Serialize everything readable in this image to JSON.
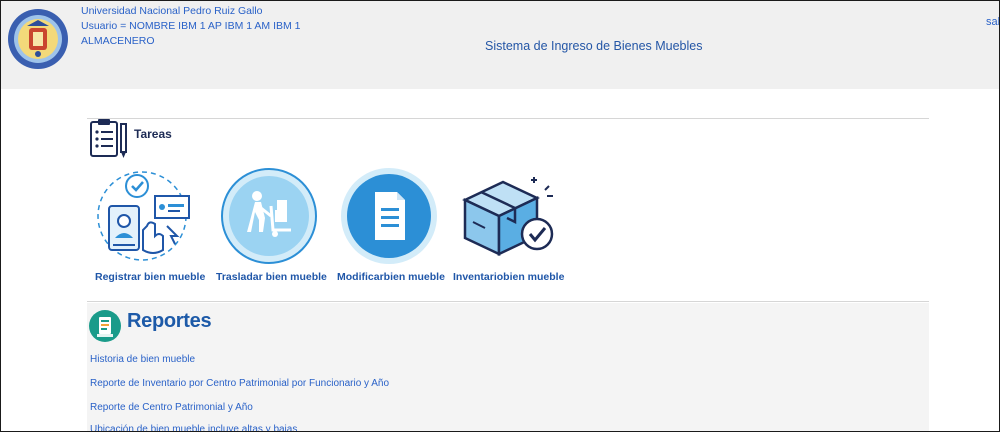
{
  "header": {
    "university": "Universidad Nacional Pedro Ruiz Gallo",
    "user_line": "Usuario = NOMBRE IBM 1 AP IBM 1 AM IBM 1",
    "role": "ALMACENERO",
    "system_title": "Sistema de Ingreso de Bienes Muebles",
    "logout": "sal"
  },
  "tareas": {
    "title": "Tareas",
    "items": [
      {
        "label": "Registrar bien mueble",
        "icon": "register-user-icon"
      },
      {
        "label": "Trasladar bien mueble",
        "icon": "hand-truck-icon"
      },
      {
        "label": "Modificarbien mueble",
        "icon": "document-icon"
      },
      {
        "label": "Inventariobien mueble",
        "icon": "box-check-icon"
      }
    ]
  },
  "reportes": {
    "title": "Reportes",
    "links": [
      "Historia de bien mueble",
      "Reporte de Inventario por Centro Patrimonial por Funcionario y Año",
      "Reporte de Centro Patrimonial y Año",
      "Ubicación de bien mueble incluye altas y bajas"
    ]
  },
  "colors": {
    "header_bg": "#f0f0f0",
    "link": "#2a62c8",
    "task_label": "#1f56a8",
    "icon_blue": "#2c8fd6"
  }
}
